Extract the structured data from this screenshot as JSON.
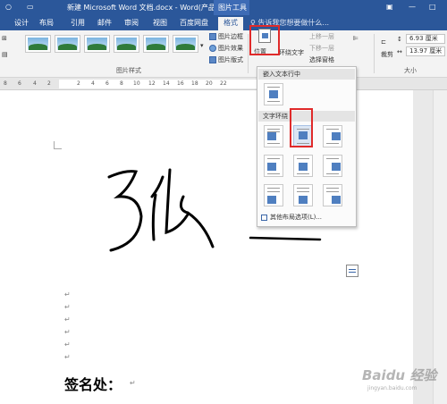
{
  "titlebar": {
    "doc_title": "新建 Microsoft Word 文档.docx - Word(产品...",
    "context": "图片工具"
  },
  "tabs": [
    {
      "label": "设计"
    },
    {
      "label": "布局"
    },
    {
      "label": "引用"
    },
    {
      "label": "邮件"
    },
    {
      "label": "审阅"
    },
    {
      "label": "视图"
    },
    {
      "label": "百度网盘"
    },
    {
      "label": "格式"
    }
  ],
  "tell_me": "告诉我您想要做什么...",
  "ribbon": {
    "picture_border": "图片边框",
    "picture_effects": "图片效果",
    "picture_layout": "图片版式",
    "picture_styles_group": "图片样式",
    "position": "位置",
    "wrap_text": "环绕文字",
    "bring_forward": "上移一层",
    "send_backward": "下移一层",
    "selection_pane": "选择窗格",
    "crop": "裁剪",
    "size_group": "大小",
    "height": "6.93 厘米",
    "width": "13.97 厘米"
  },
  "ruler": {
    "ticks": [
      "8",
      "6",
      "4",
      "2",
      "2",
      "4",
      "6",
      "8",
      "10",
      "12",
      "14",
      "16",
      "18",
      "20",
      "22"
    ]
  },
  "dropdown": {
    "inline_header": "嵌入文本行中",
    "wrap_header": "文字环绕",
    "more_options": "其他布局选项(L)..."
  },
  "document": {
    "signature_label": "签名处：",
    "para_mark": "↵"
  },
  "watermark": {
    "brand": "Baidu 经验",
    "sub": "jingyan.baidu.com"
  },
  "colors": {
    "accent": "#2b579a",
    "highlight": "#e02a2a"
  }
}
